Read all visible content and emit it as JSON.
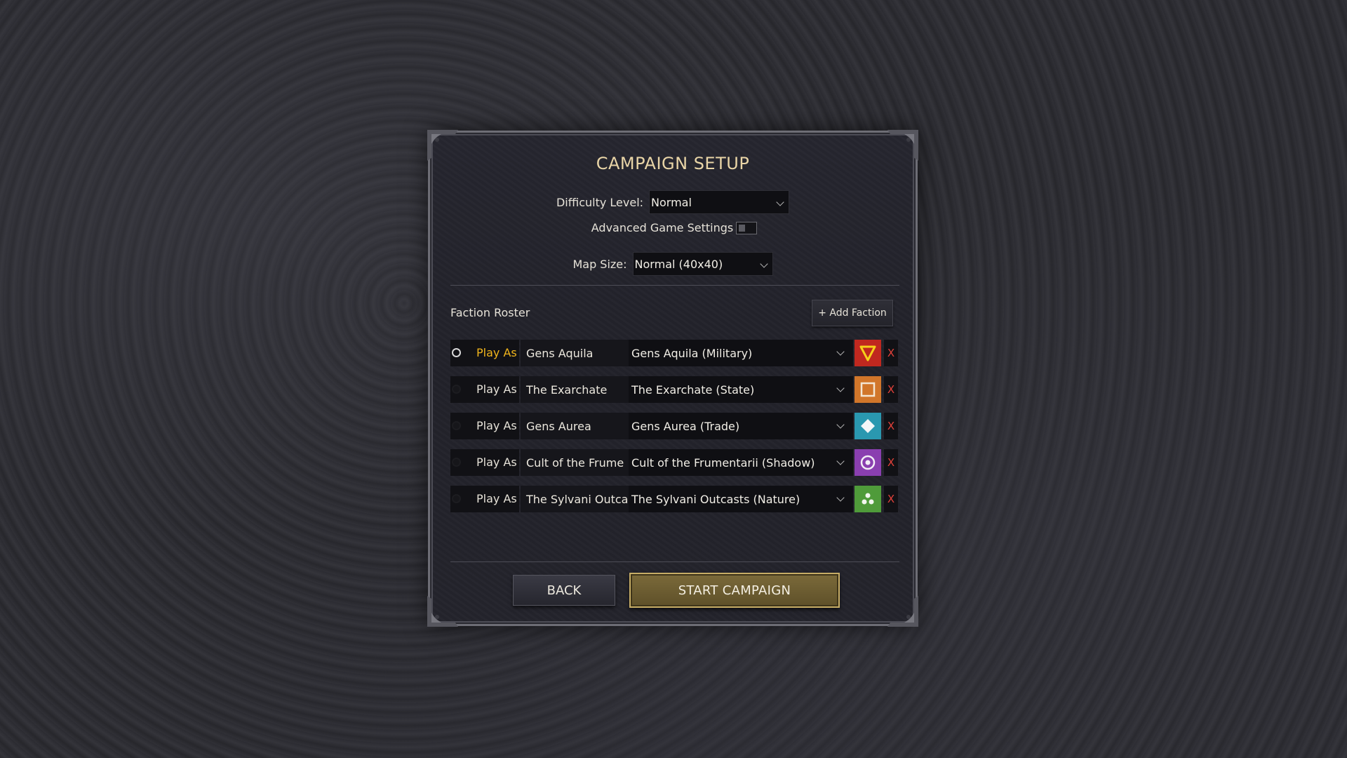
{
  "title": "CAMPAIGN SETUP",
  "settings": {
    "difficulty_label": "Difficulty Level:",
    "difficulty_value": "Normal",
    "advanced_label": "Advanced Game Settings",
    "advanced_enabled": false,
    "map_size_label": "Map Size:",
    "map_size_value": "Normal (40x40)"
  },
  "roster": {
    "label": "Faction Roster",
    "add_button": "+ Add Faction",
    "play_as_label": "Play As",
    "remove_label": "X",
    "factions": [
      {
        "name": "Gens Aquila",
        "selection": "Gens Aquila (Military)",
        "selected": true,
        "icon": "triangle-down-icon",
        "color": "#c0281f"
      },
      {
        "name": "The Exarchate",
        "selection": "The Exarchate (State)",
        "selected": false,
        "icon": "square-icon",
        "color": "#d1762a"
      },
      {
        "name": "Gens Aurea",
        "selection": "Gens Aurea (Trade)",
        "selected": false,
        "icon": "diamond-icon",
        "color": "#2a98b0"
      },
      {
        "name": "Cult of the Frume",
        "selection": "Cult of the Frumentarii (Shadow)",
        "selected": false,
        "icon": "ring-icon",
        "color": "#8a3fb0"
      },
      {
        "name": "The Sylvani Outca",
        "selection": "The Sylvani Outcasts (Nature)",
        "selected": false,
        "icon": "three-dots-icon",
        "color": "#4f9b3a"
      }
    ]
  },
  "buttons": {
    "back": "BACK",
    "start": "START CAMPAIGN"
  },
  "colors": {
    "title": "#e9d5a7",
    "active_play_as": "#f1b51c",
    "remove": "#e3413a",
    "start_border": "#c7ad66"
  }
}
